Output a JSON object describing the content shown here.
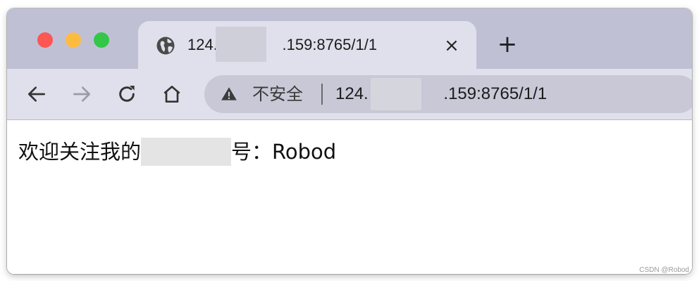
{
  "tab": {
    "title": "124.               .159:8765/1/1",
    "favicon_icon": "globe-icon",
    "close_label": "×"
  },
  "new_tab_label": "+",
  "toolbar": {
    "back_icon": "arrow-left-icon",
    "forward_icon": "arrow-right-icon",
    "reload_icon": "reload-icon",
    "home_icon": "home-icon"
  },
  "address": {
    "security_label": "不安全",
    "security_icon": "warning-triangle-icon",
    "url": "124.                .159:8765/1/1"
  },
  "page": {
    "text_prefix": "欢迎关注我的",
    "text_suffix": "号：Robod"
  },
  "watermark": "CSDN @Robod",
  "colors": {
    "titlebar": "#c0c0d5",
    "tab_active": "#e0e0ec",
    "omnibox": "#c8c8d7",
    "traffic_red": "#fc5753",
    "traffic_yellow": "#fdbc40",
    "traffic_green": "#33c748"
  }
}
